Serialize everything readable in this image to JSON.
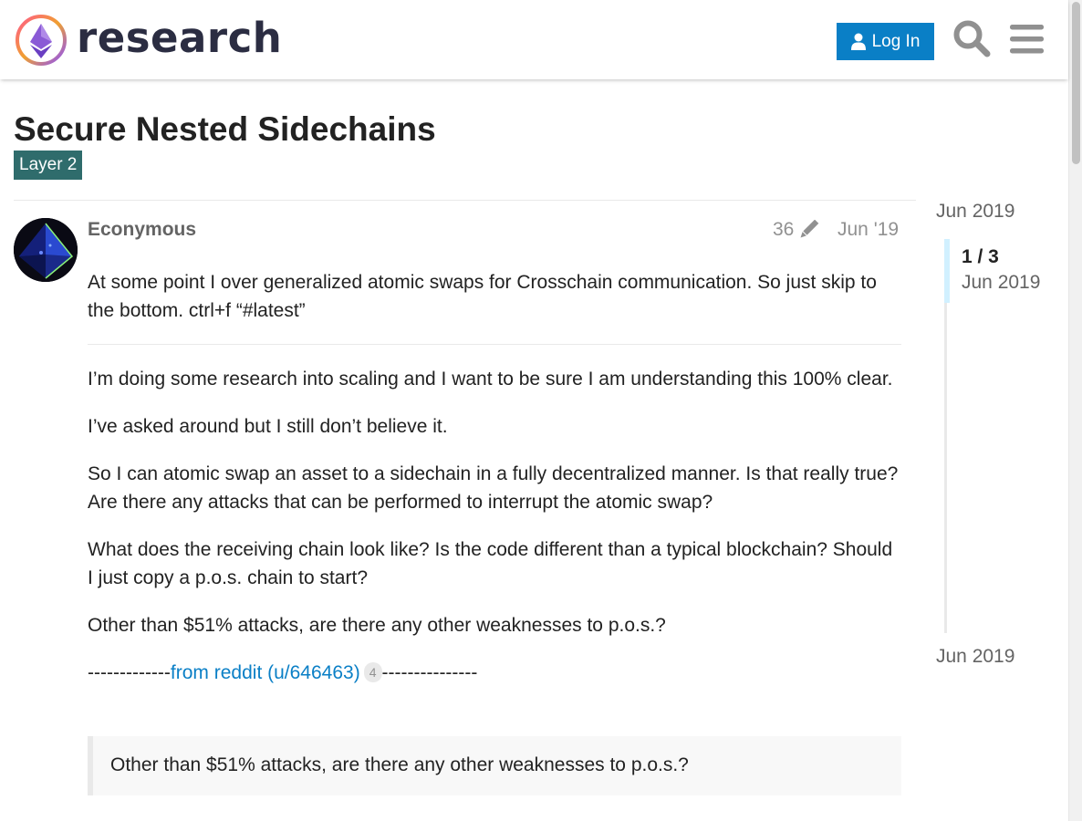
{
  "header": {
    "site_name": "research",
    "login_label": "Log In",
    "icons": [
      "logo-icon",
      "user-icon",
      "search-icon",
      "menu-icon"
    ]
  },
  "topic": {
    "title": "Secure Nested Sidechains",
    "category": "Layer 2",
    "category_color": "#2f6c6c"
  },
  "post": {
    "username": "Econymous",
    "edit_count": "36",
    "date": "Jun '19",
    "intro": "At some point I over generalized atomic swaps for Crosschain communication. So just skip to the bottom. ctrl+f “#latest”",
    "paragraphs": [
      "I’m doing some research into scaling and I want to be sure I am understanding this 100% clear.",
      "I’ve asked around but I still don’t believe it.",
      "So I can atomic swap an asset to a sidechain in a fully decentralized manner. Is that really true? Are there any attacks that can be performed to interrupt the atomic swap?",
      "What does the receiving chain look like? Is the code different than a typical blockchain? Should I just copy a p.o.s. chain to start?",
      "Other than $51% attacks, are there any other weaknesses to p.o.s.?"
    ],
    "link_prefix": "-------------",
    "link_text": "from reddit (u/646463)",
    "link_clicks": "4",
    "link_suffix": "---------------",
    "quote": "Other than $51% attacks, are there any other weaknesses to p.o.s.?"
  },
  "timeline": {
    "top_date": "Jun 2019",
    "position": "1 / 3",
    "position_date": "Jun 2019",
    "bottom_date": "Jun 2019"
  },
  "colors": {
    "accent": "#0a7fc6",
    "timeline_handle": "#d1f0ff"
  }
}
